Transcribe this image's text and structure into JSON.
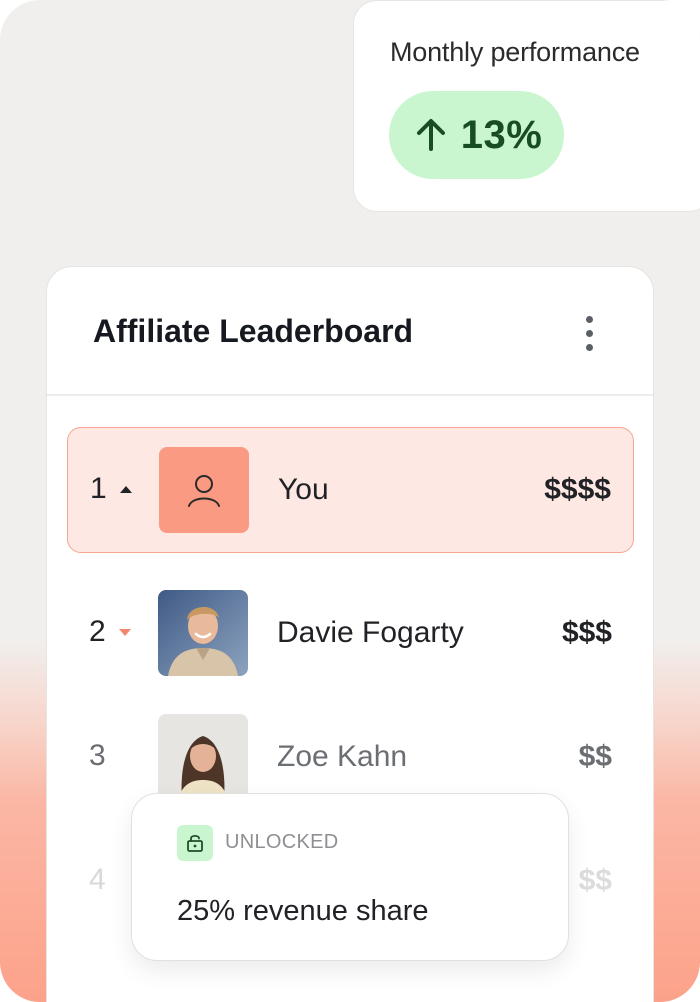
{
  "performance": {
    "title": "Monthly performance",
    "value": "13%",
    "trend_icon": "arrow-up-icon",
    "pill_color": "#c9f6cf",
    "value_color": "#184d24"
  },
  "leaderboard": {
    "title": "Affiliate Leaderboard",
    "menu_icon": "more-vertical-icon",
    "highlight_color": "#fde8e3",
    "accent_color": "#fb9a82",
    "rows": [
      {
        "rank": "1",
        "trend": "up",
        "name": "You",
        "amount": "$$$$",
        "avatar": "user-icon"
      },
      {
        "rank": "2",
        "trend": "down",
        "name": "Davie Fogarty",
        "amount": "$$$",
        "avatar": "photo"
      },
      {
        "rank": "3",
        "trend": "",
        "name": "Zoe Kahn",
        "amount": "$$",
        "avatar": "photo"
      },
      {
        "rank": "4",
        "trend": "",
        "name": "",
        "amount": "$$",
        "avatar": ""
      }
    ]
  },
  "popup": {
    "label": "UNLOCKED",
    "icon": "unlock-icon",
    "text": "25% revenue share"
  }
}
